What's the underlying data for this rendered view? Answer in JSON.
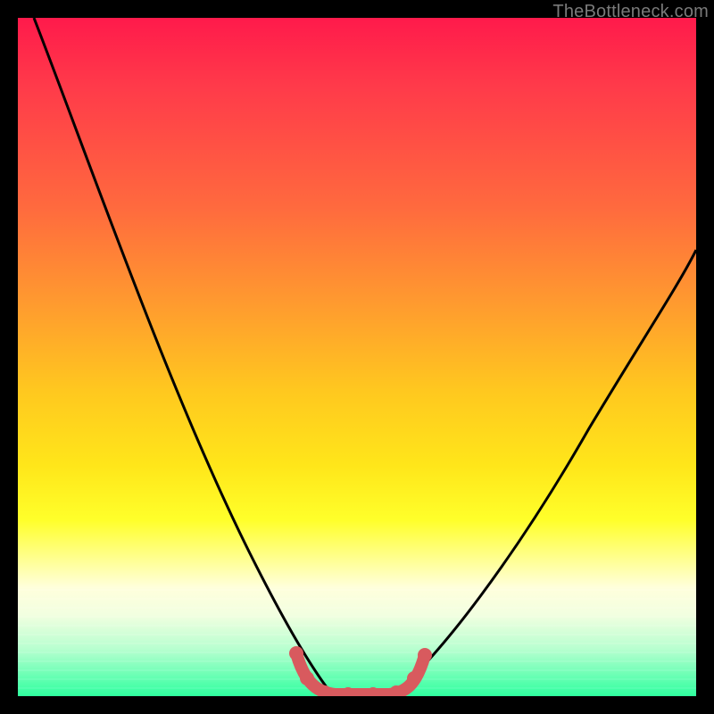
{
  "watermark": "TheBottleneck.com",
  "colors": {
    "curve_main": "#000000",
    "curve_u": "#d85a5e",
    "bg_top": "#ff1a4b",
    "bg_mid": "#ffe61a",
    "bg_bottom": "#2fff9f"
  },
  "chart_data": {
    "type": "line",
    "title": "",
    "xlabel": "",
    "ylabel": "",
    "xlim": [
      0,
      100
    ],
    "ylim": [
      0,
      100
    ],
    "grid": false,
    "legend": false,
    "note": "No axis ticks or labels are visible; x/y are expressed as percent of plot area (0=left/bottom, 100=right/top). Values estimated from pixel positions.",
    "series": [
      {
        "name": "left-descending-curve",
        "color": "#000000",
        "x": [
          2,
          6,
          10,
          14,
          18,
          22,
          26,
          30,
          33,
          36,
          38,
          40,
          42,
          44,
          46
        ],
        "y": [
          100,
          90,
          80,
          70,
          60,
          50,
          40,
          30,
          22,
          15,
          10,
          6,
          3,
          1,
          0
        ]
      },
      {
        "name": "right-ascending-curve",
        "color": "#000000",
        "x": [
          55,
          58,
          62,
          66,
          70,
          74,
          78,
          82,
          86,
          90,
          94,
          98,
          100
        ],
        "y": [
          0,
          2,
          6,
          11,
          17,
          23,
          30,
          37,
          44,
          51,
          58,
          64,
          67
        ]
      },
      {
        "name": "bottom-u-marker",
        "color": "#d85a5e",
        "x": [
          40,
          42,
          44,
          46,
          48,
          50,
          52,
          54,
          56,
          58
        ],
        "y": [
          6,
          3,
          1,
          0,
          0,
          0,
          0,
          1,
          3,
          6
        ]
      }
    ]
  }
}
